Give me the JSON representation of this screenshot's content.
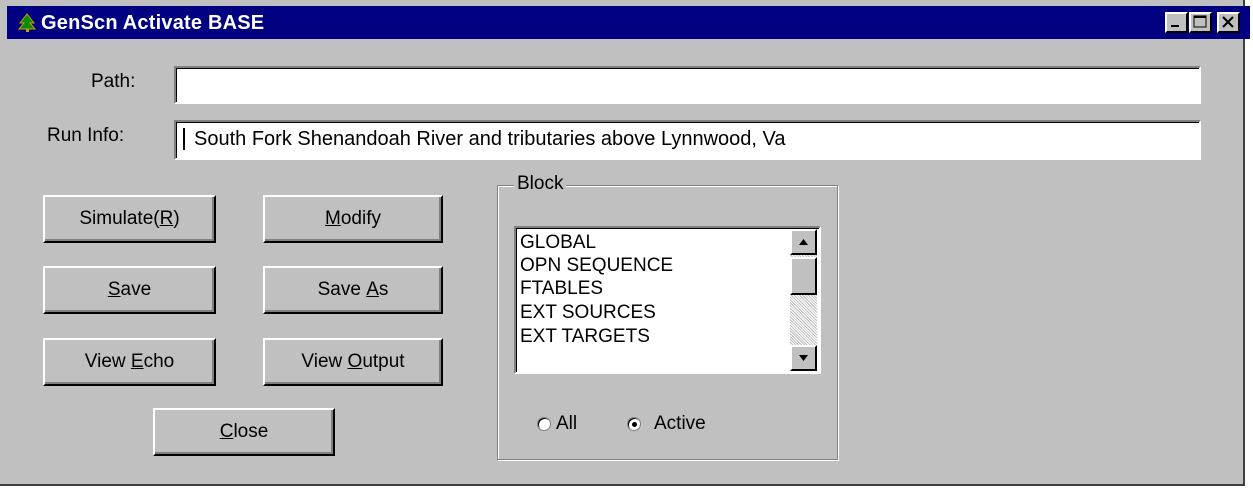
{
  "window": {
    "title": "GenScn Activate BASE",
    "minimize_label": "Minimize",
    "maximize_label": "Maximize",
    "close_label": "Close window"
  },
  "fields": {
    "path_label": "Path:",
    "path_value": "",
    "runinfo_label": "Run Info:",
    "runinfo_value": "South Fork Shenandoah River and tributaries above Lynnwood, Va"
  },
  "buttons": {
    "simulate": {
      "pre": "Simulate(",
      "key": "R",
      "post": ")"
    },
    "modify": {
      "pre": "",
      "key": "M",
      "post": "odify"
    },
    "save": {
      "pre": "",
      "key": "S",
      "post": "ave"
    },
    "save_as": {
      "pre": "Save ",
      "key": "A",
      "post": "s"
    },
    "view_echo": {
      "pre": "View ",
      "key": "E",
      "post": "cho"
    },
    "view_output": {
      "pre": "View ",
      "key": "O",
      "post": "utput"
    },
    "close": {
      "pre": "",
      "key": "C",
      "post": "lose"
    }
  },
  "block": {
    "legend": "Block",
    "items": [
      "GLOBAL",
      "OPN SEQUENCE",
      "FTABLES",
      "EXT SOURCES",
      "EXT TARGETS"
    ],
    "radio_all": "All",
    "radio_active": "Active",
    "selected": "Active"
  },
  "colors": {
    "titlebar": "#000080",
    "face": "#c0c0c0"
  }
}
